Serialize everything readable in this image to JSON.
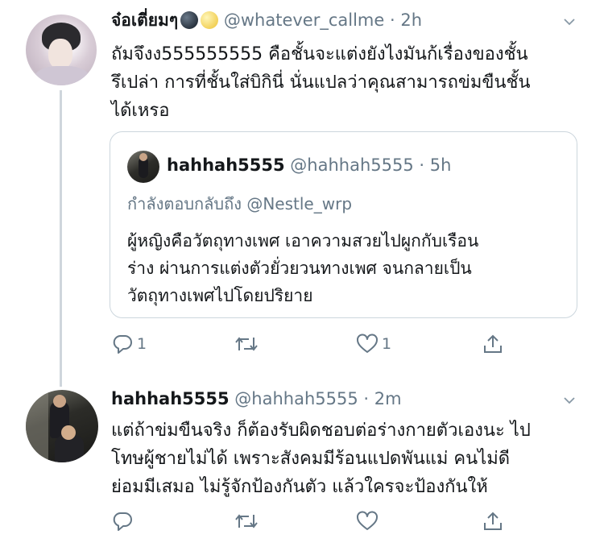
{
  "tweet1": {
    "display_name": "จ๋อเตี่ยมๆ",
    "emoji": [
      "new-moon-face-emoji",
      "full-moon-face-emoji"
    ],
    "handle": "@whatever_callme",
    "separator": "·",
    "time": "2h",
    "text_lines": [
      "ถัมจึงง555555555 คือชั้นจะแต่งยังไงมันก้เรื่องของชั้น",
      "รึเปล่า การที่ชั้นใส่บิกินี่ นั่นแปลว่าคุณสามารถข่มขืนชั้น",
      "ได้เหรอ"
    ],
    "quoted": {
      "display_name": "hahhah5555",
      "handle": "@hahhah5555",
      "separator": "·",
      "time": "5h",
      "replying_to": "กำลังตอบกลับถึง @Nestle_wrp",
      "text_lines": [
        "ผู้หญิงคือวัตถุทางเพศ เอาความสวยไปผูกกับเรือน",
        "ร่าง ผ่านการแต่งตัวยั่วยวนทางเพศ จนกลายเป็น",
        "วัตถุทางเพศไปโดยปริยาย"
      ]
    },
    "actions": {
      "reply_count": "1",
      "retweet_count": "",
      "like_count": "1"
    }
  },
  "tweet2": {
    "display_name": "hahhah5555",
    "handle": "@hahhah5555",
    "separator": "·",
    "time": "2m",
    "text_lines": [
      "แต่ถ้าข่มขืนจริง ก็ต้องรับผิดชอบต่อร่างกายตัวเองนะ ไป",
      "โทษผู้ชายไม่ได้ เพราะสังคมมีร้อนแปดพันแม่ คนไม่ดี",
      "ย่อมมีเสมอ ไม่รู้จักป้องกันตัว แล้วใครจะป้องกันให้"
    ],
    "actions": {
      "reply_count": "",
      "retweet_count": "",
      "like_count": ""
    }
  },
  "colors": {
    "text": "#14171a",
    "secondary": "#657786",
    "border": "#ccd6dd",
    "thread_line": "#cfd6dc"
  }
}
